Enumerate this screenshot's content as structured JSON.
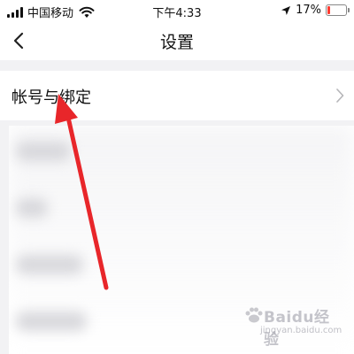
{
  "status_bar": {
    "carrier": "中国移动",
    "time": "下午4:33",
    "battery_percent": "17%",
    "battery_level": 0.17,
    "battery_color": "#ff3b30",
    "icons": [
      "signal-icon",
      "wifi-icon",
      "location-arrow-icon",
      "battery-icon"
    ]
  },
  "nav": {
    "title": "设置",
    "back_icon": "chevron-left-icon"
  },
  "settings": {
    "account_binding_label": "帐号与绑定",
    "chevron_icon": "chevron-right-icon"
  },
  "annotation": {
    "arrow_color": "#e8262a"
  },
  "watermark": {
    "brand": "Baidu经验",
    "sub": "jingyan.baidu.com"
  }
}
